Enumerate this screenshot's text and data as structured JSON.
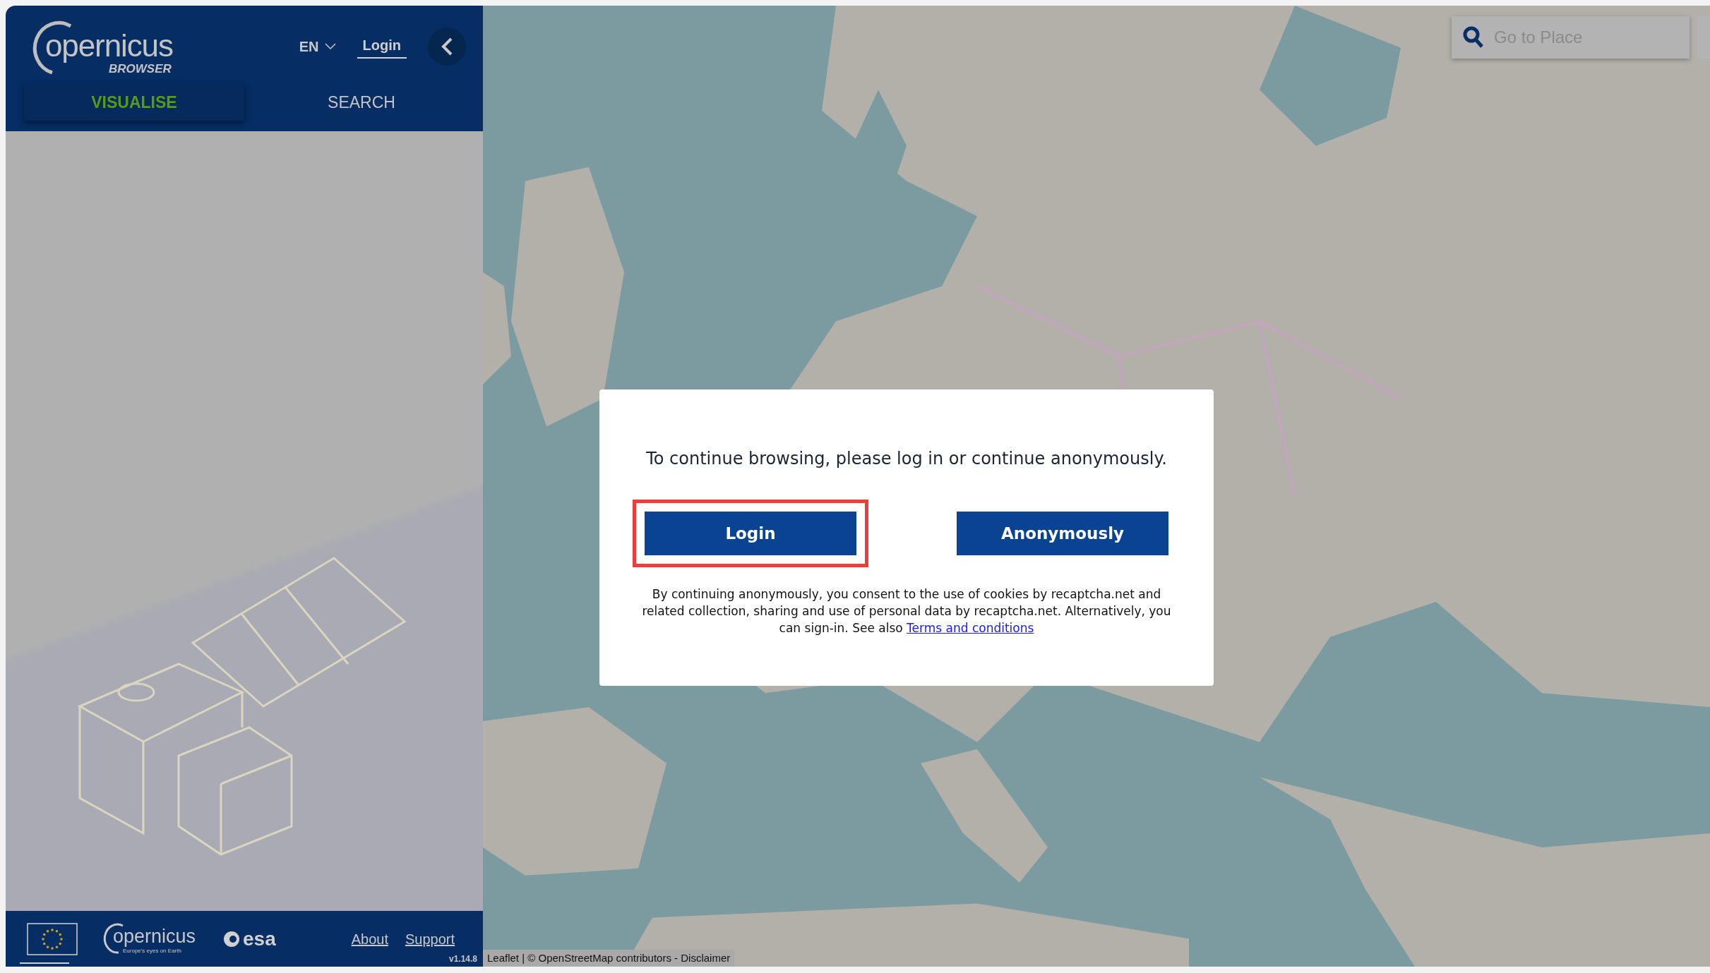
{
  "sidebar": {
    "logo": {
      "wordmark": "opernicus",
      "subtitle": "BROWSER"
    },
    "language": "EN",
    "login_link": "Login",
    "tabs": [
      {
        "label": "VISUALISE",
        "selected": true
      },
      {
        "label": "SEARCH",
        "selected": false
      }
    ],
    "footer": {
      "partner_wordmark": "opernicus",
      "partner_tagline": "Europe's eyes on Earth",
      "agency": "esa",
      "links": [
        "About",
        "Support"
      ],
      "version": "v1.14.8"
    }
  },
  "map": {
    "search": {
      "placeholder": "Go to Place"
    },
    "attribution": "Leaflet | © OpenStreetMap contributors - Disclaimer"
  },
  "dialog": {
    "message": "To continue browsing, please log in or continue anonymously.",
    "buttons": [
      {
        "label": "Login",
        "highlighted": true
      },
      {
        "label": "Anonymously",
        "highlighted": false
      }
    ],
    "notice": "By continuing anonymously, you consent to the use of cookies by recaptcha.net and related collection, sharing and use of personal data by recaptcha.net. Alternatively, you can sign-in. See also",
    "link": "Terms and conditions"
  }
}
